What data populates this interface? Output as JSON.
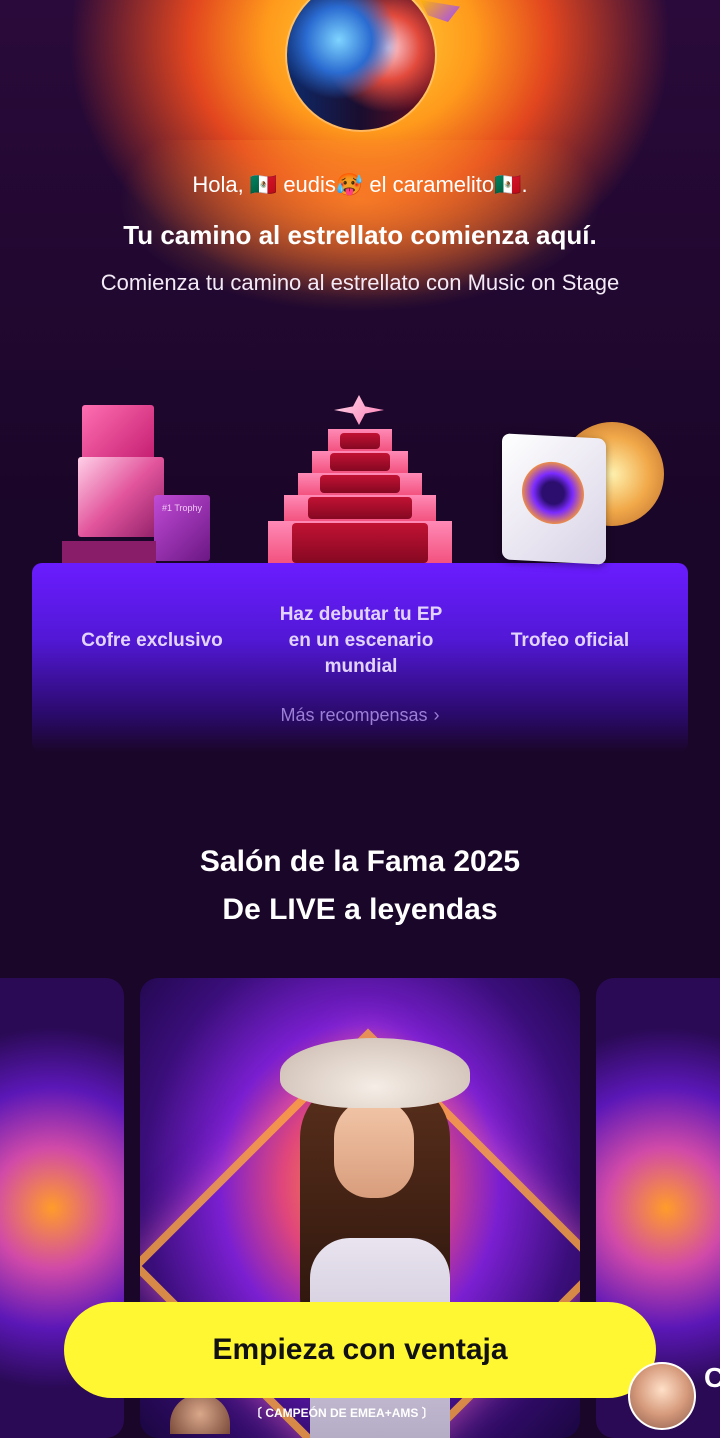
{
  "header": {
    "greeting": "Hola, 🇲🇽 eudis🥵 el caramelito🇲🇽.",
    "headline": "Tu camino al estrellato comienza aquí.",
    "subline": "Comienza tu camino al estrellato con Music on Stage"
  },
  "rewards": {
    "items": [
      {
        "label": "Cofre exclusivo"
      },
      {
        "label": "Haz debutar tu EP en un escenario mundial"
      },
      {
        "label": "Trofeo oficial"
      }
    ],
    "more_label": "Más recompensas",
    "chest_box_text": "#1 Trophy"
  },
  "hall_of_fame": {
    "title_line1": "Salón de la Fama 2025",
    "title_line2": "De LIVE a leyendas",
    "card_caption": "CAMPEÓN DE EMEA+AMS",
    "next_card_initial": "C"
  },
  "cta": {
    "label": "Empieza con ventaja"
  },
  "colors": {
    "cta_bg": "#fef731",
    "stage_purple": "#6a1cff",
    "reward_text": "#e3d4ff",
    "muted_link": "#9c7ed6"
  }
}
